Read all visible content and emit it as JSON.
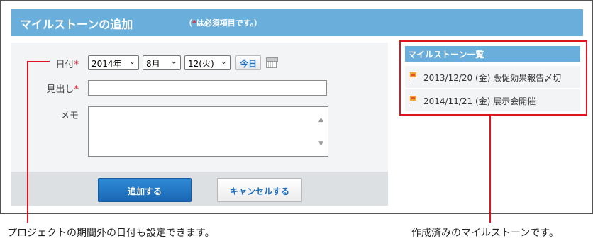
{
  "header": {
    "title": "マイルストーンの追加",
    "note_prefix": "（",
    "note_required_mark": "*",
    "note_suffix": "は必須項目です。）"
  },
  "form": {
    "date_label": "日付",
    "required_mark": "*",
    "year_value": "2014年",
    "month_value": "8月",
    "day_value": "12(火)",
    "today_button": "今日",
    "title_label": "見出し",
    "title_value": "",
    "memo_label": "メモ",
    "memo_value": ""
  },
  "actions": {
    "add_label": "追加する",
    "cancel_label": "キャンセルする"
  },
  "milestones": {
    "header": "マイルストーン一覧",
    "items": [
      {
        "label": "2013/12/20 (金) 販促効果報告〆切"
      },
      {
        "label": "2014/11/21 (金) 展示会開催"
      }
    ]
  },
  "annotations": {
    "date_caption": "プロジェクトの期間外の日付も設定できます。",
    "list_caption": "作成済みのマイルストーンです。"
  },
  "colors": {
    "header_blue": "#6aaedb",
    "callout_red": "#e0141e",
    "primary_button": "#1967b4"
  },
  "icons": {
    "calendar": "calendar-icon",
    "milestone": "flag-icon",
    "dropdown": "chevron-down-icon"
  }
}
